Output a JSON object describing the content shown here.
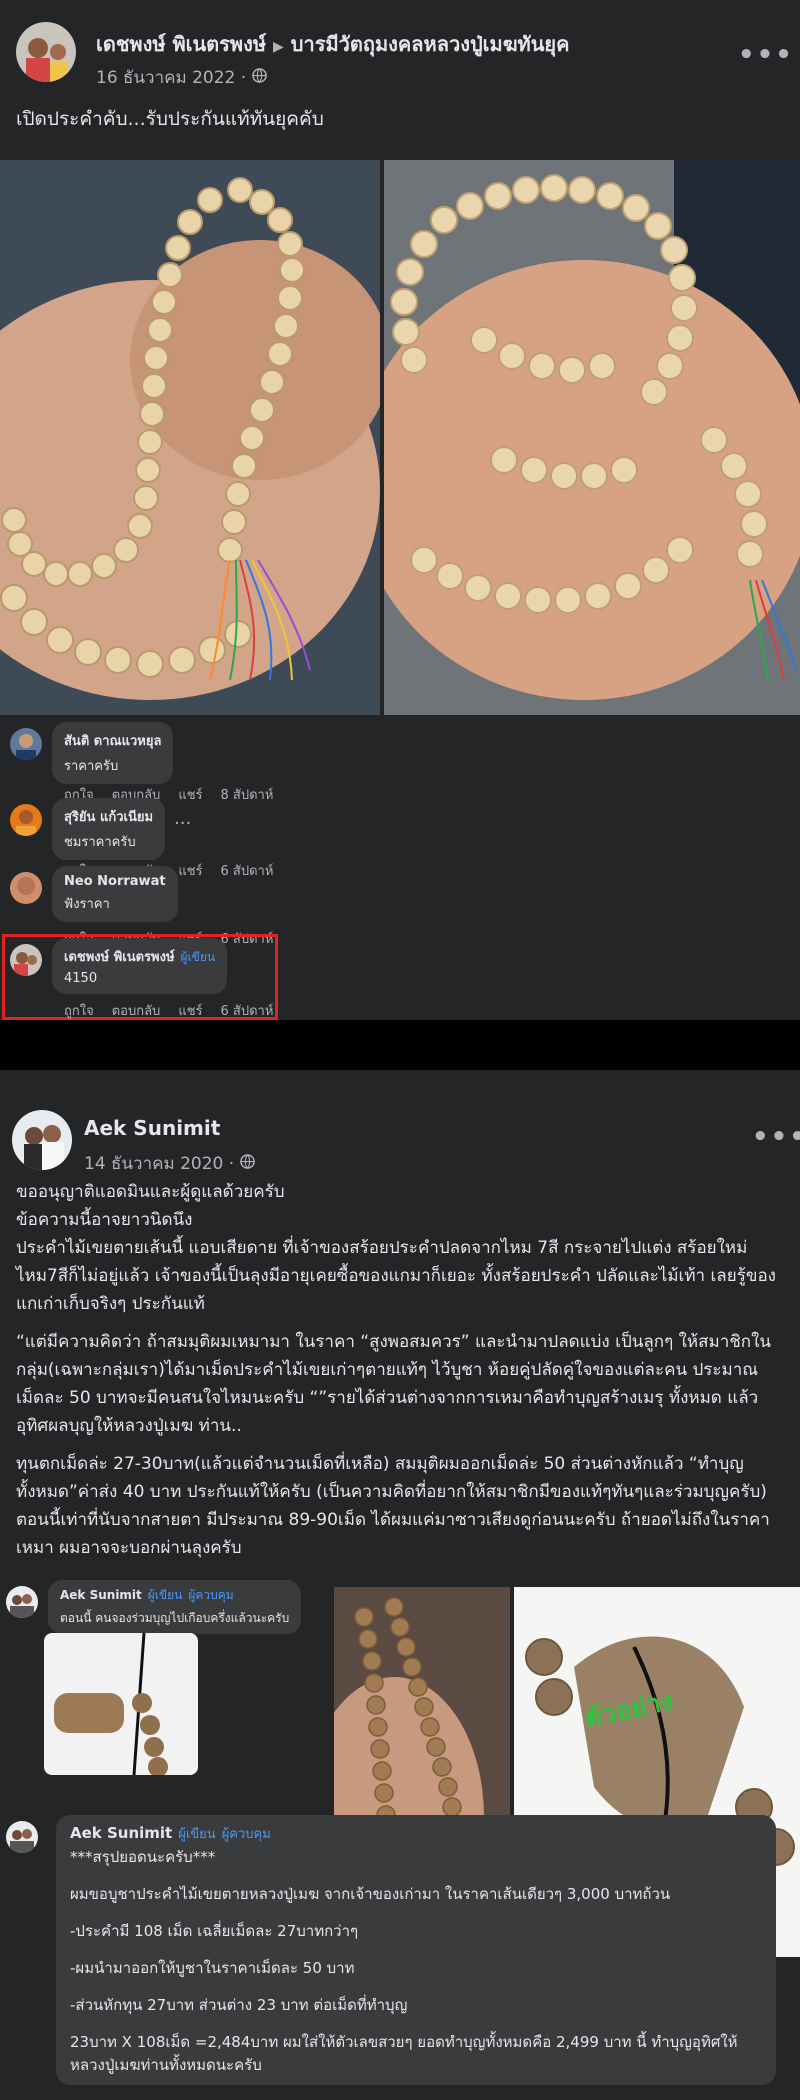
{
  "post1": {
    "author": "เดชพงษ์ พิเนตรพงษ์",
    "group": "บารมีวัตถุมงคลหลวงปู่เมฆทันยุค",
    "date": "16 ธันวาคม 2022 ·",
    "text": "เปิดประคำคับ...รับประกันแท้ทันยุคคับ",
    "comments": [
      {
        "name": "สันติ ดาณแวหยุล",
        "text": "ราคาครับ",
        "like": "ถูกใจ",
        "reply": "ตอบกลับ",
        "share": "แชร์",
        "time": "8 สัปดาห์",
        "badge": ""
      },
      {
        "name": "สุริยัน แก้วเนียม",
        "text": "ชมราคาครับ",
        "like": "ถูกใจ",
        "reply": "ตอบกลับ",
        "share": "แชร์",
        "time": "6 สัปดาห์",
        "badge": ""
      },
      {
        "name": "Neo Norrawat",
        "text": "ฟังราคา",
        "like": "ถูกใจ",
        "reply": "ตอบกลับ",
        "share": "แชร์",
        "time": "6 สัปดาห์",
        "badge": ""
      },
      {
        "name": "เดชพงษ์ พิเนตรพงษ์",
        "text": "4150",
        "like": "ถูกใจ",
        "reply": "ตอบกลับ",
        "share": "แชร์",
        "time": "6 สัปดาห์",
        "badge": "ผู้เขียน"
      }
    ],
    "ellipsis": "..."
  },
  "post2": {
    "author": "Aek Sunimit",
    "date": "14 ธันวาคม 2020 ·",
    "paragraphs": [
      "ขออนุญาติแอดมินและผู้ดูแลด้วยครับ",
      "ข้อความนี้อาจยาวนิดนึง",
      "ประคำไม้เขยตายเส้นนี้ แอบเสียดาย ที่เจ้าของสร้อยประคำปลดจากไหม 7สี กระจายไปแต่ง สร้อยใหม่ ไหม7สีก็ไม่อยู่แล้ว เจ้าของนี้เป็นลุงมีอายุเคยซื้อของแกมาก็เยอะ ทั้งสร้อยประคำ ปลัดและไม้เท้า เลยรู้ของแกเก่าเก็บจริงๆ ประกันแท้",
      "“แต่มีความคิดว่า ถ้าสมมุติผมเหมามา ในราคา “สูงพอสมควร” และนำมาปลดแบ่ง เป็นลูกๆ ให้สมาชิกในกลุ่ม(เฉพาะกลุ่มเรา)ได้มาเม็ดประคำไม้เขยเก่าๆตายแท้ๆ ไว้บูชา ห้อยคู่ปลัดคู่ใจของแต่ละคน ประมาณ เม็ดละ 50 บาทจะมีคนสนใจไหมนะครับ “”รายได้ส่วนต่างจากการเหมาคือทำบุญสร้างเมรุ ทั้งหมด แล้วอุทิศผลบุญให้หลวงปู่เมฆ ท่าน..",
      "ทุนตกเม็ดล่ะ 27-30บาท(แล้วแต่จำนวนเม็ดที่เหลือ) สมมุติผมออกเม็ดล่ะ 50 ส่วนต่างหักแล้ว “ทำบุญทั้งหมด”ค่าส่ง 40 บาท ประกันแท้ให้ครับ (เป็นความคิดที่อยากให้สมาชิกมีของแท้ๆทันๆและร่วมบุญครับ) ตอนนี้เท่าที่นับจากสายตา มีประมาณ 89-90เม็ด ได้ผมแค่มาซาวเสียงดูก่อนนะครับ ถ้ายอดไม่ถึงในราคาเหมา ผมอาจจะบอกผ่านลุงครับ"
    ],
    "comment1": {
      "name": "Aek Sunimit",
      "badge1": "ผู้เขียน",
      "badge2": "ผู้ควบคุม",
      "text": "ตอนนี้ คนจองร่วมบุญไปเกือบครึ่งแล้วนะครับ"
    },
    "photo_caption": "ตัวอย่าง",
    "comment2": {
      "name": "Aek Sunimit",
      "badge1": "ผู้เขียน",
      "badge2": "ผู้ควบคุม",
      "lines": [
        "***สรุปยอดนะครับ***",
        "ผมขอบูชาประคำไม้เขยตายหลวงปู่เมฆ จากเจ้าของเก่ามา ในราคาเส้นเดียวๆ 3,000 บาทถ้วน",
        "-ประคำมี 108 เม็ด เฉลี่ยเม็ดละ 27บาทกว่าๆ",
        "-ผมนำมาออกให้บูชาในราคาเม็ดละ 50 บาท",
        "-ส่วนหักทุน 27บาท ส่วนต่าง 23 บาท ต่อเม็ดที่ทำบุญ",
        "23บาท X 108เม็ด =2,484บาท ผมใส่ให้ตัวเลขสวยๆ ยอดทำบุญทั้งหมดคือ 2,499 บาท นี้ ทำบุญอุทิศให้หลวงปู่เมฆท่านทั้งหมดนะครับ"
      ]
    }
  },
  "colors": {
    "accent": "#4599ff",
    "highlight": "#e02424",
    "bg": "#242526",
    "bubble": "#3a3b3c"
  }
}
